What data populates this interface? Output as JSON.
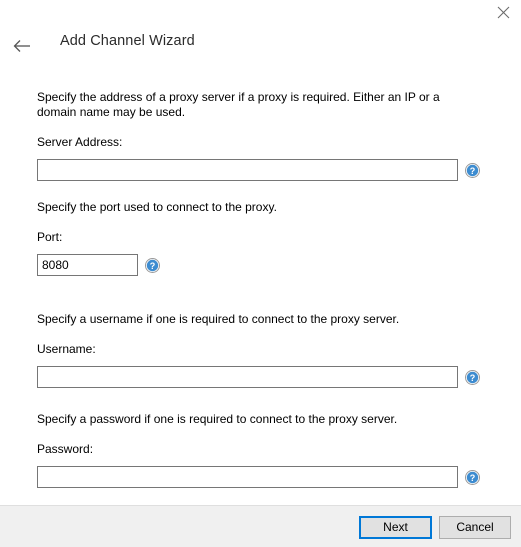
{
  "window": {
    "close_icon": "close-icon",
    "back_icon": "back-arrow-icon",
    "title": "Add Channel Wizard"
  },
  "form": {
    "sections": [
      {
        "description": "Specify the address of a proxy server if a proxy is required. Either an IP or a domain name may be used.",
        "label": "Server Address:",
        "value": "",
        "placeholder": "",
        "help_icon": "help-icon"
      },
      {
        "description": "Specify the port used to connect to the proxy.",
        "label": "Port:",
        "value": "8080",
        "placeholder": "",
        "help_icon": "help-icon"
      },
      {
        "description": "Specify a username if one is required to connect to the proxy server.",
        "label": "Username:",
        "value": "",
        "placeholder": "",
        "help_icon": "help-icon"
      },
      {
        "description": "Specify a password if one is required to connect to the proxy server.",
        "label": "Password:",
        "value": "",
        "placeholder": "",
        "help_icon": "help-icon"
      }
    ]
  },
  "footer": {
    "next_label": "Next",
    "cancel_label": "Cancel"
  },
  "colors": {
    "accent": "#0078d7",
    "help_blue": "#3d8cd0",
    "footer_bg": "#f0f0f0",
    "button_bg": "#e1e1e1",
    "input_border": "#767676"
  }
}
